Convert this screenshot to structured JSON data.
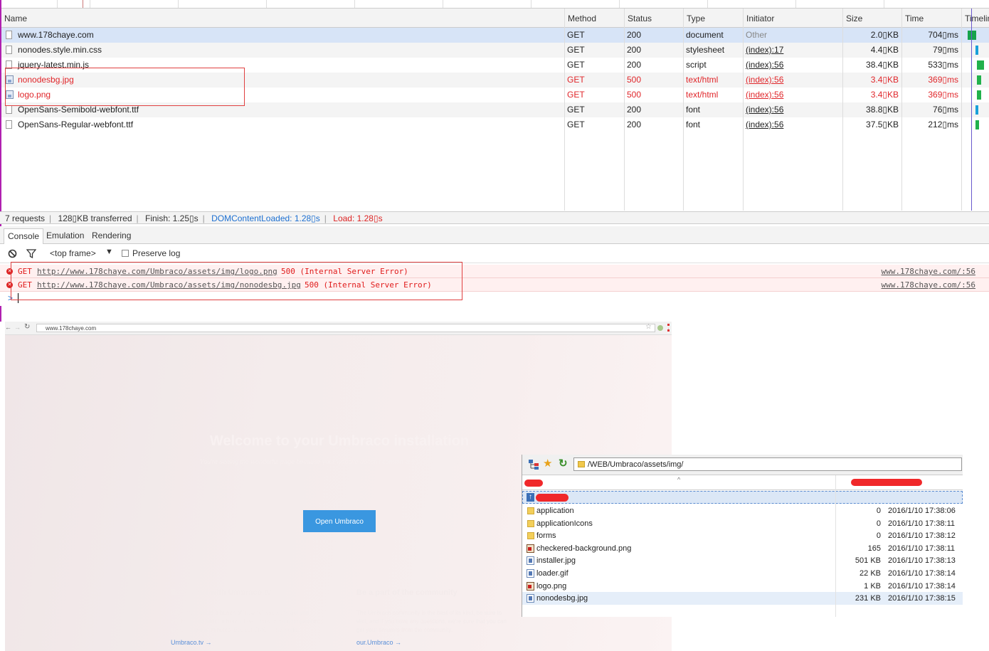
{
  "network": {
    "columns": [
      "Name",
      "Method",
      "Status",
      "Type",
      "Initiator",
      "Size",
      "Time",
      "Timeline"
    ],
    "rows": [
      {
        "name": "www.178chaye.com",
        "method": "GET",
        "status": "200",
        "type": "document",
        "initiator": "Other",
        "size": "2.0▯KB",
        "time": "704▯ms",
        "error": false,
        "icon": "document",
        "selected": true,
        "timeline_color": "#16a34a"
      },
      {
        "name": "nonodes.style.min.css",
        "method": "GET",
        "status": "200",
        "type": "stylesheet",
        "initiator": "(index):17",
        "size": "4.4▯KB",
        "time": "79▯ms",
        "error": false,
        "icon": "document",
        "selected": false,
        "timeline_color": "#1aa0d8"
      },
      {
        "name": "jquery-latest.min.js",
        "method": "GET",
        "status": "200",
        "type": "script",
        "initiator": "(index):56",
        "size": "38.4▯KB",
        "time": "533▯ms",
        "error": false,
        "icon": "document",
        "selected": false,
        "timeline_color": "#22b14c"
      },
      {
        "name": "nonodesbg.jpg",
        "method": "GET",
        "status": "500",
        "type": "text/html",
        "initiator": "(index):56",
        "size": "3.4▯KB",
        "time": "369▯ms",
        "error": true,
        "icon": "image",
        "selected": false,
        "timeline_color": "#22b14c"
      },
      {
        "name": "logo.png",
        "method": "GET",
        "status": "500",
        "type": "text/html",
        "initiator": "(index):56",
        "size": "3.4▯KB",
        "time": "369▯ms",
        "error": true,
        "icon": "image",
        "selected": false,
        "timeline_color": "#22b14c"
      },
      {
        "name": "OpenSans-Semibold-webfont.ttf",
        "method": "GET",
        "status": "200",
        "type": "font",
        "initiator": "(index):56",
        "size": "38.8▯KB",
        "time": "76▯ms",
        "error": false,
        "icon": "document",
        "selected": false,
        "timeline_color": "#1aa0d8"
      },
      {
        "name": "OpenSans-Regular-webfont.ttf",
        "method": "GET",
        "status": "200",
        "type": "font",
        "initiator": "(index):56",
        "size": "37.5▯KB",
        "time": "212▯ms",
        "error": false,
        "icon": "document",
        "selected": false,
        "timeline_color": "#22b14c"
      }
    ]
  },
  "status_bar": {
    "requests": "7 requests",
    "transferred": "128▯KB transferred",
    "finish": "Finish: 1.25▯s",
    "dom_loaded": "DOMContentLoaded: 1.28▯s",
    "load": "Load: 1.28▯s"
  },
  "drawer_tabs": [
    "Console",
    "Emulation",
    "Rendering"
  ],
  "console": {
    "frame_select": "<top frame>",
    "preserve_log": "Preserve log",
    "messages": [
      {
        "method": "GET",
        "url": "http://www.178chaye.com/Umbraco/assets/img/logo.png",
        "text": "500 (Internal Server Error)",
        "source": "www.178chaye.com/:56"
      },
      {
        "method": "GET",
        "url": "http://www.178chaye.com/Umbraco/assets/img/nonodesbg.jpg",
        "text": "500 (Internal Server Error)",
        "source": "www.178chaye.com/:56"
      }
    ],
    "prompt": ">"
  },
  "browser": {
    "url": "www.178chaye.com",
    "title": "Welcome to your Umbraco installation",
    "subtitle": "You're seeing the wonderful page because your website doesn't contain any published content yet.",
    "button": "Open Umbraco",
    "col1_heading": "Easy start with Umbraco.tv",
    "col1_text": "We have created a bunch of 'how-to' videos, to get you easily started with Umbraco. Learn how to build projects in just a couple of minutes. Easiest CMS in the world.",
    "col1_link": "Umbraco.tv →",
    "col2_heading": "Be a part of the community",
    "col2_text": "The Umbraco community is the best of its kind, be sure to visit, and if you have any questions, we're sure that you can get your answers from the community.",
    "col2_link": "our.Umbraco →"
  },
  "ftp": {
    "path": "/WEB/Umbraco/assets/img/",
    "entries": [
      {
        "name": "application",
        "size": "0",
        "date": "2016/1/10 17:38:06",
        "kind": "folder"
      },
      {
        "name": "applicationIcons",
        "size": "0",
        "date": "2016/1/10 17:38:11",
        "kind": "folder"
      },
      {
        "name": "forms",
        "size": "0",
        "date": "2016/1/10 17:38:12",
        "kind": "folder"
      },
      {
        "name": "checkered-background.png",
        "size": "165",
        "date": "2016/1/10 17:38:11",
        "kind": "png"
      },
      {
        "name": "installer.jpg",
        "size": "501 KB",
        "date": "2016/1/10 17:38:13",
        "kind": "jpg"
      },
      {
        "name": "loader.gif",
        "size": "22 KB",
        "date": "2016/1/10 17:38:14",
        "kind": "jpg"
      },
      {
        "name": "logo.png",
        "size": "1 KB",
        "date": "2016/1/10 17:38:14",
        "kind": "png"
      },
      {
        "name": "nonodesbg.jpg",
        "size": "231 KB",
        "date": "2016/1/10 17:38:15",
        "kind": "jpg",
        "selected": true
      }
    ]
  }
}
